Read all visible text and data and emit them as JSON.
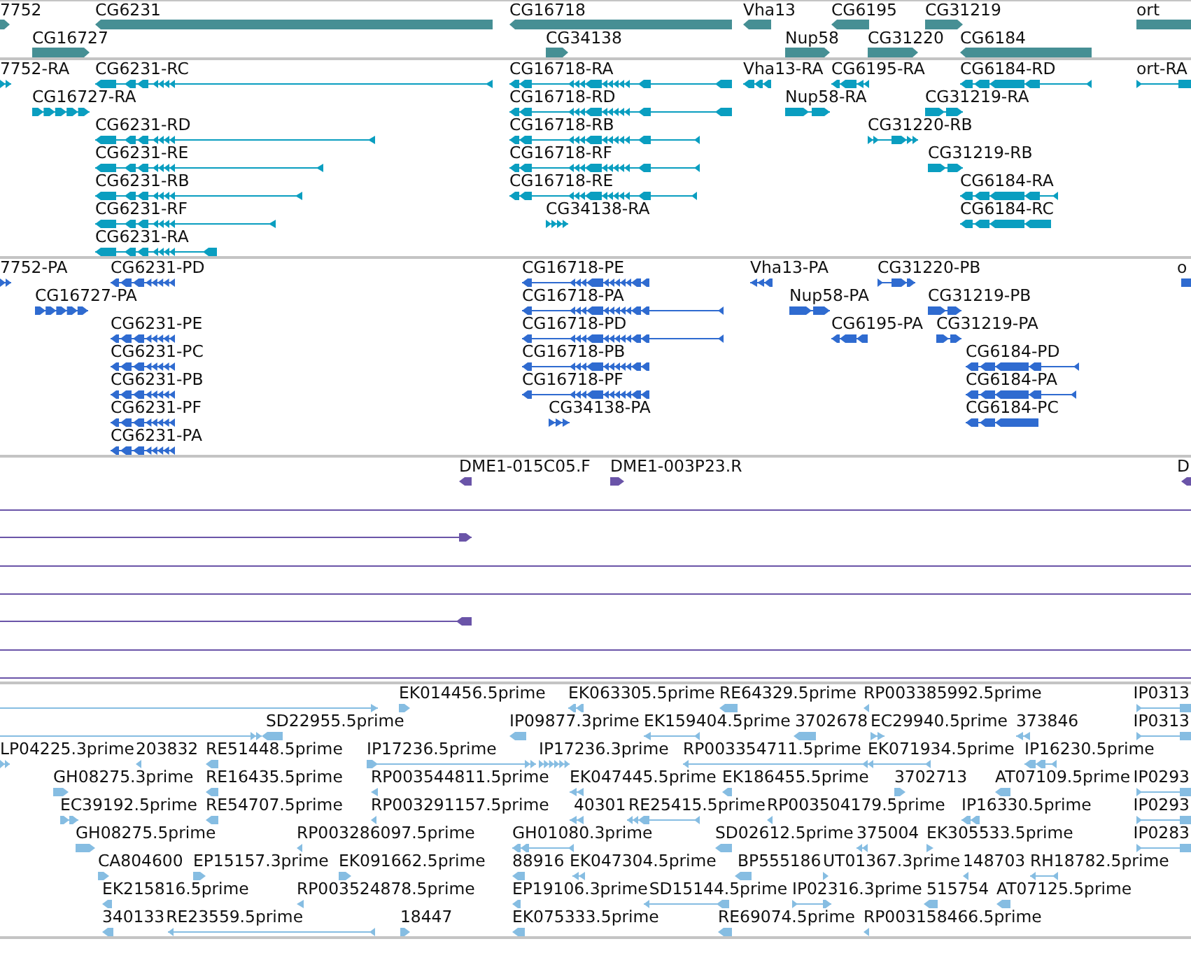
{
  "tracks": [
    {
      "kind": "gene",
      "features": [
        {
          "label": "7752",
          "reverse": false
        },
        {
          "label": "CG6231",
          "reverse": true
        },
        {
          "label": "CG16718",
          "reverse": true
        },
        {
          "label": "Vha13",
          "reverse": true
        },
        {
          "label": "CG6195",
          "reverse": true
        },
        {
          "label": "CG31219",
          "reverse": false
        },
        {
          "label": "ort"
        },
        {
          "label": "CG16727",
          "reverse": false
        },
        {
          "label": "CG34138",
          "reverse": false
        },
        {
          "label": "Nup58",
          "reverse": false
        },
        {
          "label": "CG31220",
          "reverse": false
        },
        {
          "label": "CG6184",
          "reverse": true
        }
      ]
    },
    {
      "kind": "transcript",
      "features": [
        {
          "label": "7752-RA",
          "reverse": false
        },
        {
          "label": "CG6231-RC",
          "reverse": true
        },
        {
          "label": "CG16718-RA",
          "reverse": true
        },
        {
          "label": "Vha13-RA",
          "reverse": true
        },
        {
          "label": "CG6195-RA",
          "reverse": true
        },
        {
          "label": "CG6184-RD",
          "reverse": true
        },
        {
          "label": "ort-RA",
          "reverse": false
        },
        {
          "label": "CG16727-RA",
          "reverse": false
        },
        {
          "label": "CG16718-RD",
          "reverse": true
        },
        {
          "label": "Nup58-RA",
          "reverse": false
        },
        {
          "label": "CG31219-RA",
          "reverse": false
        },
        {
          "label": "CG6231-RD",
          "reverse": true
        },
        {
          "label": "CG16718-RB",
          "reverse": true
        },
        {
          "label": "CG31220-RB",
          "reverse": false
        },
        {
          "label": "CG6231-RE",
          "reverse": true
        },
        {
          "label": "CG16718-RF",
          "reverse": true
        },
        {
          "label": "CG31219-RB",
          "reverse": false
        },
        {
          "label": "CG6231-RB",
          "reverse": true
        },
        {
          "label": "CG16718-RE",
          "reverse": true
        },
        {
          "label": "CG6184-RA",
          "reverse": true
        },
        {
          "label": "CG6231-RF",
          "reverse": true
        },
        {
          "label": "CG34138-RA",
          "reverse": false
        },
        {
          "label": "CG6184-RC",
          "reverse": true
        },
        {
          "label": "CG6231-RA",
          "reverse": true
        }
      ]
    },
    {
      "kind": "protein",
      "features": [
        {
          "label": "7752-PA",
          "reverse": false
        },
        {
          "label": "CG6231-PD",
          "reverse": true
        },
        {
          "label": "CG16718-PE",
          "reverse": true
        },
        {
          "label": "Vha13-PA",
          "reverse": true
        },
        {
          "label": "CG31220-PB",
          "reverse": false
        },
        {
          "label": "o"
        },
        {
          "label": "CG16727-PA",
          "reverse": false
        },
        {
          "label": "CG16718-PA",
          "reverse": true
        },
        {
          "label": "Nup58-PA",
          "reverse": false
        },
        {
          "label": "CG31219-PB",
          "reverse": false
        },
        {
          "label": "CG6231-PE",
          "reverse": true
        },
        {
          "label": "CG16718-PD",
          "reverse": true
        },
        {
          "label": "CG6195-PA",
          "reverse": true
        },
        {
          "label": "CG31219-PA",
          "reverse": false
        },
        {
          "label": "CG6231-PC",
          "reverse": true
        },
        {
          "label": "CG16718-PB",
          "reverse": true
        },
        {
          "label": "CG6184-PD",
          "reverse": true
        },
        {
          "label": "CG6231-PB",
          "reverse": true
        },
        {
          "label": "CG16718-PF",
          "reverse": true
        },
        {
          "label": "CG6184-PA",
          "reverse": true
        },
        {
          "label": "CG6231-PF",
          "reverse": true
        },
        {
          "label": "CG34138-PA",
          "reverse": false
        },
        {
          "label": "CG6184-PC",
          "reverse": true
        },
        {
          "label": "CG6231-PA",
          "reverse": true
        }
      ]
    },
    {
      "kind": "clone",
      "features": [
        {
          "kind": "read",
          "label": "DME1-015C05.F",
          "reverse": true
        },
        {
          "kind": "read",
          "label": "DME1-003P23.R",
          "reverse": false
        },
        {
          "kind": "read",
          "label": "D",
          "reverse": true
        },
        {
          "kind": "span"
        },
        {
          "kind": "span",
          "reverse": false
        },
        {
          "kind": "span"
        },
        {
          "kind": "span"
        },
        {
          "kind": "span",
          "reverse": true
        },
        {
          "kind": "span"
        },
        {
          "kind": "span"
        }
      ]
    },
    {
      "kind": "est",
      "features": [
        {
          "reverse": false
        },
        {
          "label": "EK014456.5prime",
          "reverse": false
        },
        {
          "label": "EK063305.5prime",
          "reverse": true
        },
        {
          "label": "RE64329.5prime",
          "reverse": true
        },
        {
          "label": "RP003385992.5prime",
          "reverse": true
        },
        {
          "label": "IP0313",
          "reverse": false
        },
        {
          "reverse": false
        },
        {
          "label": "SD22955.5prime",
          "reverse": true
        },
        {
          "label": "IP09877.3prime",
          "reverse": true
        },
        {
          "label": "EK159404.5prime",
          "reverse": true
        },
        {
          "label": "3702678",
          "reverse": true
        },
        {
          "label": "EC29940.5prime",
          "reverse": false
        },
        {
          "label": "373846",
          "reverse": true
        },
        {
          "label": "IP0313",
          "reverse": false
        },
        {
          "label": "LP04225.3prime",
          "reverse": false
        },
        {
          "label": "203832",
          "reverse": true
        },
        {
          "label": "RE51448.5prime",
          "reverse": true
        },
        {
          "label": "IP17236.5prime",
          "reverse": false
        },
        {
          "label": "IP17236.3prime",
          "reverse": false
        },
        {
          "label": "RP003354711.5prime",
          "reverse": true
        },
        {
          "label": "EK071934.5prime",
          "reverse": true
        },
        {
          "label": "IP16230.5prime",
          "reverse": true
        },
        {
          "label": "GH08275.3prime",
          "reverse": false
        },
        {
          "label": "RE16435.5prime",
          "reverse": true
        },
        {
          "label": "RP003544811.5prime",
          "reverse": true
        },
        {
          "label": "EK047445.5prime",
          "reverse": true
        },
        {
          "label": "EK186455.5prime",
          "reverse": true
        },
        {
          "label": "3702713",
          "reverse": false
        },
        {
          "label": "AT07109.5prime",
          "reverse": true
        },
        {
          "label": "IP0293",
          "reverse": false
        },
        {
          "label": "EC39192.5prime",
          "reverse": false
        },
        {
          "label": "RE54707.5prime",
          "reverse": true
        },
        {
          "label": "RP003291157.5prime",
          "reverse": true
        },
        {
          "label": "40301",
          "reverse": true
        },
        {
          "label": "RE25415.5prime",
          "reverse": true
        },
        {
          "label": "RP003504179.5prime",
          "reverse": true
        },
        {
          "label": "IP16330.5prime",
          "reverse": true
        },
        {
          "label": "IP0293",
          "reverse": false
        },
        {
          "label": "GH08275.5prime",
          "reverse": false
        },
        {
          "label": "RP003286097.5prime",
          "reverse": true
        },
        {
          "label": "GH01080.3prime",
          "reverse": true
        },
        {
          "label": "SD02612.5prime",
          "reverse": true
        },
        {
          "label": "375004",
          "reverse": true
        },
        {
          "label": "EK305533.5prime",
          "reverse": false
        },
        {
          "label": "IP0283",
          "reverse": false
        },
        {
          "label": "CA804600",
          "reverse": false
        },
        {
          "label": "EP15157.3prime",
          "reverse": false
        },
        {
          "label": "EK091662.5prime",
          "reverse": false
        },
        {
          "label": "88916",
          "reverse": true
        },
        {
          "label": "EK047304.5prime",
          "reverse": true
        },
        {
          "label": "BP555186",
          "reverse": true
        },
        {
          "label": "UT01367.3prime",
          "reverse": false
        },
        {
          "label": "148703",
          "reverse": true
        },
        {
          "label": "RH18782.5prime",
          "reverse": true
        },
        {
          "label": "EK215816.5prime",
          "reverse": true
        },
        {
          "label": "RP003524878.5prime",
          "reverse": true
        },
        {
          "label": "EP19106.3prime",
          "reverse": true
        },
        {
          "label": "SD15144.5prime",
          "reverse": true
        },
        {
          "label": "IP02316.3prime",
          "reverse": false
        },
        {
          "label": "515754",
          "reverse": true
        },
        {
          "label": "AT07125.5prime",
          "reverse": true
        },
        {
          "label": "340133",
          "reverse": true
        },
        {
          "label": "RE23559.5prime",
          "reverse": true
        },
        {
          "label": "18447",
          "reverse": false
        },
        {
          "label": "EK075333.5prime",
          "reverse": true
        },
        {
          "label": "RE69074.5prime",
          "reverse": true
        },
        {
          "label": "RP003158466.5prime",
          "reverse": true
        }
      ]
    }
  ]
}
